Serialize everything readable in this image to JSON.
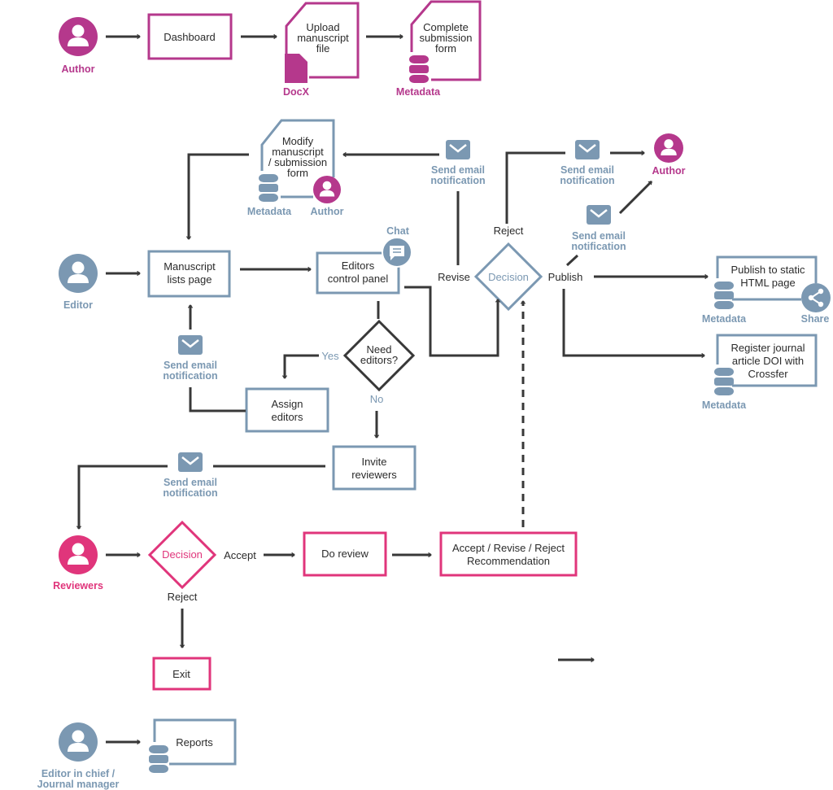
{
  "colors": {
    "author": "#b5388c",
    "editor": "#7b98b2",
    "reviewer": "#e0357b",
    "line": "#383838"
  },
  "author_flow": {
    "actor": "Author",
    "dashboard": "Dashboard",
    "upload": [
      "Upload",
      "manuscript",
      "file"
    ],
    "docx": "DocX",
    "complete": [
      "Complete",
      "submission",
      "form"
    ],
    "metadata": "Metadata"
  },
  "modify": {
    "lines": [
      "Modify",
      "manuscript",
      "/ submission",
      "form"
    ],
    "metadata": "Metadata",
    "author": "Author"
  },
  "email": {
    "l1": "Send email",
    "l2": "notification"
  },
  "editor_flow": {
    "actor": "Editor",
    "manuscript_lists": [
      "Manuscript",
      "lists page"
    ],
    "control_panel": [
      "Editors",
      "control panel"
    ],
    "chat": "Chat",
    "need_editors": [
      "Need",
      "editors?"
    ],
    "yes": "Yes",
    "no": "No",
    "assign": [
      "Assign",
      "editors"
    ],
    "invite": [
      "Invite",
      "reviewers"
    ]
  },
  "decision": {
    "label": "Decision",
    "revise": "Revise",
    "reject": "Reject",
    "publish": "Publish",
    "author": "Author"
  },
  "publish": {
    "box": [
      "Publish to static",
      "HTML page"
    ],
    "metadata": "Metadata",
    "share": "Share"
  },
  "register": {
    "box": [
      "Register journal",
      "article DOI with",
      "Crossfer"
    ],
    "metadata": "Metadata"
  },
  "reviewer_flow": {
    "actor": "Reviewers",
    "decision": "Decision",
    "accept": "Accept",
    "reject": "Reject",
    "do_review": "Do review",
    "recommendation": [
      "Accept / Revise / Reject",
      "Recommendation"
    ],
    "exit": "Exit"
  },
  "chief": {
    "actor": [
      "Editor in chief /",
      "Journal manager"
    ],
    "reports": "Reports"
  },
  "icons": [
    "person-icon",
    "database-icon",
    "file-icon",
    "mail-icon",
    "chat-icon",
    "share-icon"
  ]
}
